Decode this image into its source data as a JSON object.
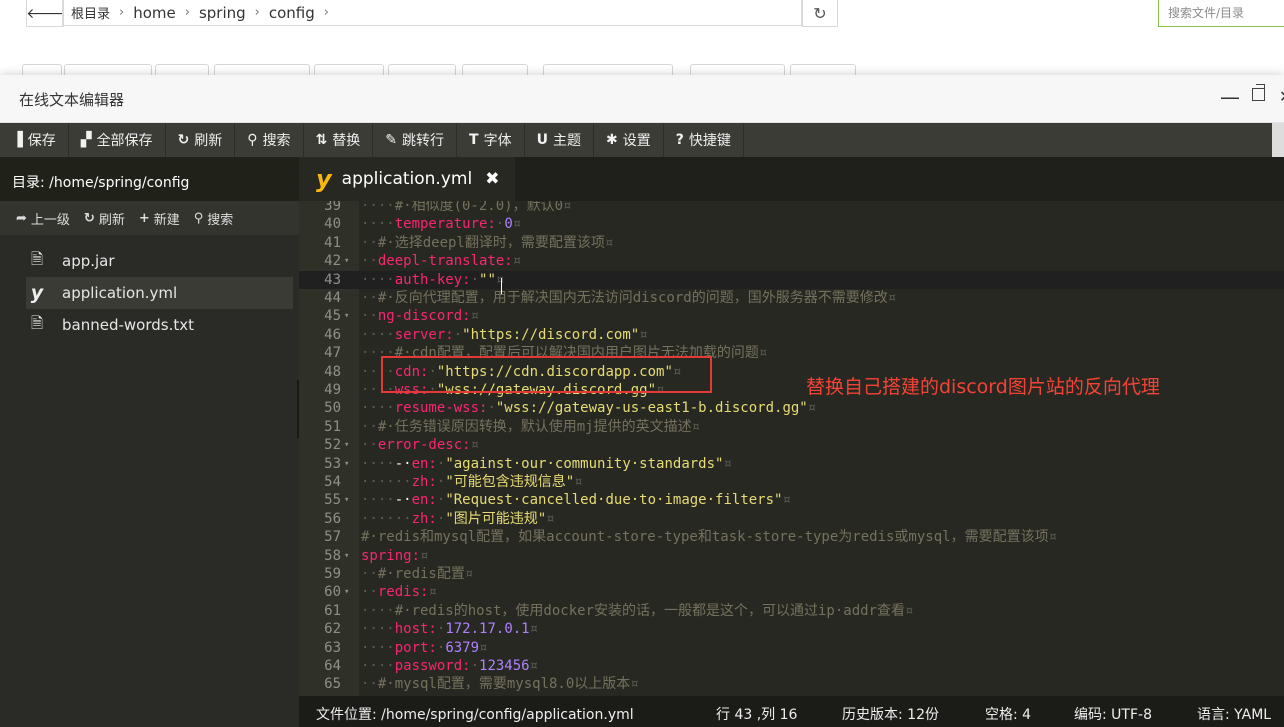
{
  "file_manager": {
    "breadcrumb": [
      "根目录",
      "home",
      "spring",
      "config"
    ],
    "search_placeholder": "搜索文件/目录"
  },
  "editor": {
    "title": "在线文本编辑器",
    "toolbar": [
      {
        "icon": "save-icon",
        "glyph": "▐",
        "label": "保存"
      },
      {
        "icon": "save-all-icon",
        "glyph": "▞",
        "label": "全部保存"
      },
      {
        "icon": "refresh-icon",
        "glyph": "↻",
        "label": "刷新"
      },
      {
        "icon": "search-icon",
        "glyph": "⚲",
        "label": "搜索"
      },
      {
        "icon": "replace-icon",
        "glyph": "⇅",
        "label": "替换"
      },
      {
        "icon": "pin-icon",
        "glyph": "✎",
        "label": "跳转行"
      },
      {
        "icon": "font-icon",
        "glyph": "T",
        "label": "字体"
      },
      {
        "icon": "theme-icon",
        "glyph": "U",
        "label": "主题"
      },
      {
        "icon": "gear-icon",
        "glyph": "✱",
        "label": "设置"
      },
      {
        "icon": "question-icon",
        "glyph": "?",
        "label": "快捷键"
      }
    ],
    "sidebar": {
      "directory_label": "目录: /home/spring/config",
      "actions": [
        {
          "icon": "arrow-up-icon",
          "glyph": "➦",
          "label": "上一级"
        },
        {
          "icon": "refresh-icon",
          "glyph": "↻",
          "label": "刷新"
        },
        {
          "icon": "plus-icon",
          "glyph": "+",
          "label": "新建"
        },
        {
          "icon": "search-icon",
          "glyph": "⚲",
          "label": "搜索"
        }
      ],
      "files": [
        {
          "name": "app.jar",
          "icon": "file-icon",
          "active": false
        },
        {
          "name": "application.yml",
          "icon": "yaml-icon",
          "active": true
        },
        {
          "name": "banned-words.txt",
          "icon": "file-icon",
          "active": false
        }
      ]
    },
    "tab": {
      "label": "application.yml"
    },
    "code_lines": [
      {
        "n": "39",
        "fold": false,
        "segs": [
          [
            "ws",
            "····"
          ],
          [
            "cm",
            "#·相似度(0-2.0)，默认0"
          ],
          [
            "ws",
            "¤"
          ]
        ]
      },
      {
        "n": "40",
        "fold": false,
        "segs": [
          [
            "ws",
            "····"
          ],
          [
            "k",
            "temperature:"
          ],
          [
            "ws",
            "·"
          ],
          [
            "n",
            "0"
          ],
          [
            "ws",
            "¤"
          ]
        ]
      },
      {
        "n": "41",
        "fold": false,
        "segs": [
          [
            "ws",
            "··"
          ],
          [
            "cm",
            "#·选择deepl翻译时，需要配置该项"
          ],
          [
            "ws",
            "¤"
          ]
        ]
      },
      {
        "n": "42",
        "fold": true,
        "segs": [
          [
            "ws",
            "··"
          ],
          [
            "k",
            "deepl-translate:"
          ],
          [
            "ws",
            "¤"
          ]
        ]
      },
      {
        "n": "43",
        "fold": false,
        "segs": [
          [
            "ws",
            "····"
          ],
          [
            "k",
            "auth-key:"
          ],
          [
            "ws",
            "·"
          ],
          [
            "s",
            "\"\""
          ],
          [
            "ws",
            "¤"
          ]
        ]
      },
      {
        "n": "44",
        "fold": false,
        "segs": [
          [
            "ws",
            "··"
          ],
          [
            "cm",
            "#·反向代理配置，用于解决国内无法访问discord的问题，国外服务器不需要修改"
          ],
          [
            "ws",
            "¤"
          ]
        ]
      },
      {
        "n": "45",
        "fold": true,
        "segs": [
          [
            "ws",
            "··"
          ],
          [
            "k",
            "ng-discord:"
          ],
          [
            "ws",
            "¤"
          ]
        ]
      },
      {
        "n": "46",
        "fold": false,
        "segs": [
          [
            "ws",
            "····"
          ],
          [
            "k",
            "server:"
          ],
          [
            "ws",
            "·"
          ],
          [
            "s",
            "\"https://discord.com\""
          ],
          [
            "ws",
            "¤"
          ]
        ]
      },
      {
        "n": "47",
        "fold": false,
        "segs": [
          [
            "ws",
            "····"
          ],
          [
            "cm",
            "#·cdn配置，配置后可以解决国内用户图片无法加载的问题"
          ],
          [
            "ws",
            "¤"
          ]
        ]
      },
      {
        "n": "48",
        "fold": false,
        "segs": [
          [
            "ws",
            "····"
          ],
          [
            "k",
            "cdn:"
          ],
          [
            "ws",
            "·"
          ],
          [
            "s",
            "\"https://cdn.discordapp.com\""
          ],
          [
            "ws",
            "¤"
          ]
        ]
      },
      {
        "n": "49",
        "fold": false,
        "segs": [
          [
            "ws",
            "····"
          ],
          [
            "k",
            "wss:"
          ],
          [
            "ws",
            "·"
          ],
          [
            "s",
            "\"wss://gateway.discord.gg\""
          ],
          [
            "ws",
            "¤"
          ]
        ]
      },
      {
        "n": "50",
        "fold": false,
        "segs": [
          [
            "ws",
            "····"
          ],
          [
            "k",
            "resume-wss:"
          ],
          [
            "ws",
            "·"
          ],
          [
            "s",
            "\"wss://gateway-us-east1-b.discord.gg\""
          ],
          [
            "ws",
            "¤"
          ]
        ]
      },
      {
        "n": "51",
        "fold": false,
        "segs": [
          [
            "ws",
            "··"
          ],
          [
            "cm",
            "#·任务错误原因转换，默认使用mj提供的英文描述"
          ],
          [
            "ws",
            "¤"
          ]
        ]
      },
      {
        "n": "52",
        "fold": true,
        "segs": [
          [
            "ws",
            "··"
          ],
          [
            "k",
            "error-desc:"
          ],
          [
            "ws",
            "¤"
          ]
        ]
      },
      {
        "n": "53",
        "fold": true,
        "segs": [
          [
            "ws",
            "····"
          ],
          [
            "p",
            "-·"
          ],
          [
            "k",
            "en:"
          ],
          [
            "ws",
            "·"
          ],
          [
            "s",
            "\"against·our·community·standards\""
          ],
          [
            "ws",
            "¤"
          ]
        ]
      },
      {
        "n": "54",
        "fold": false,
        "segs": [
          [
            "ws",
            "······"
          ],
          [
            "k",
            "zh:"
          ],
          [
            "ws",
            "·"
          ],
          [
            "s",
            "\"可能包含违规信息\""
          ],
          [
            "ws",
            "¤"
          ]
        ]
      },
      {
        "n": "55",
        "fold": true,
        "segs": [
          [
            "ws",
            "····"
          ],
          [
            "p",
            "-·"
          ],
          [
            "k",
            "en:"
          ],
          [
            "ws",
            "·"
          ],
          [
            "s",
            "\"Request·cancelled·due·to·image·filters\""
          ],
          [
            "ws",
            "¤"
          ]
        ]
      },
      {
        "n": "56",
        "fold": false,
        "segs": [
          [
            "ws",
            "······"
          ],
          [
            "k",
            "zh:"
          ],
          [
            "ws",
            "·"
          ],
          [
            "s",
            "\"图片可能违规\""
          ],
          [
            "ws",
            "¤"
          ]
        ]
      },
      {
        "n": "57",
        "fold": false,
        "segs": [
          [
            "cm",
            "#·redis和mysql配置，如果account-store-type和task-store-type为redis或mysql，需要配置该项"
          ],
          [
            "ws",
            "¤"
          ]
        ]
      },
      {
        "n": "58",
        "fold": true,
        "segs": [
          [
            "k",
            "spring:"
          ],
          [
            "ws",
            "¤"
          ]
        ]
      },
      {
        "n": "59",
        "fold": false,
        "segs": [
          [
            "ws",
            "··"
          ],
          [
            "cm",
            "#·redis配置"
          ],
          [
            "ws",
            "¤"
          ]
        ]
      },
      {
        "n": "60",
        "fold": true,
        "segs": [
          [
            "ws",
            "··"
          ],
          [
            "k",
            "redis:"
          ],
          [
            "ws",
            "¤"
          ]
        ]
      },
      {
        "n": "61",
        "fold": false,
        "segs": [
          [
            "ws",
            "····"
          ],
          [
            "cm",
            "#·redis的host，使用docker安装的话，一般都是这个，可以通过ip·addr查看"
          ],
          [
            "ws",
            "¤"
          ]
        ]
      },
      {
        "n": "62",
        "fold": false,
        "segs": [
          [
            "ws",
            "····"
          ],
          [
            "k",
            "host:"
          ],
          [
            "ws",
            "·"
          ],
          [
            "n",
            "172.17.0.1"
          ],
          [
            "ws",
            "¤"
          ]
        ]
      },
      {
        "n": "63",
        "fold": false,
        "segs": [
          [
            "ws",
            "····"
          ],
          [
            "k",
            "port:"
          ],
          [
            "ws",
            "·"
          ],
          [
            "n",
            "6379"
          ],
          [
            "ws",
            "¤"
          ]
        ]
      },
      {
        "n": "64",
        "fold": false,
        "segs": [
          [
            "ws",
            "····"
          ],
          [
            "k",
            "password:"
          ],
          [
            "ws",
            "·"
          ],
          [
            "n",
            "123456"
          ],
          [
            "ws",
            "¤"
          ]
        ]
      },
      {
        "n": "65",
        "fold": false,
        "segs": [
          [
            "ws",
            "··"
          ],
          [
            "cm",
            "#·mysql配置，需要mysql8.0以上版本"
          ],
          [
            "ws",
            "¤"
          ]
        ]
      }
    ],
    "annotation": "替换自己搭建的discord图片站的反向代理",
    "status": {
      "file_path": "文件位置: /home/spring/config/application.yml",
      "cursor": "行 43 ,列 16",
      "history": "历史版本: 12份",
      "indent": "空格: 4",
      "encoding": "编码: UTF-8",
      "language": "语言: YAML"
    }
  }
}
